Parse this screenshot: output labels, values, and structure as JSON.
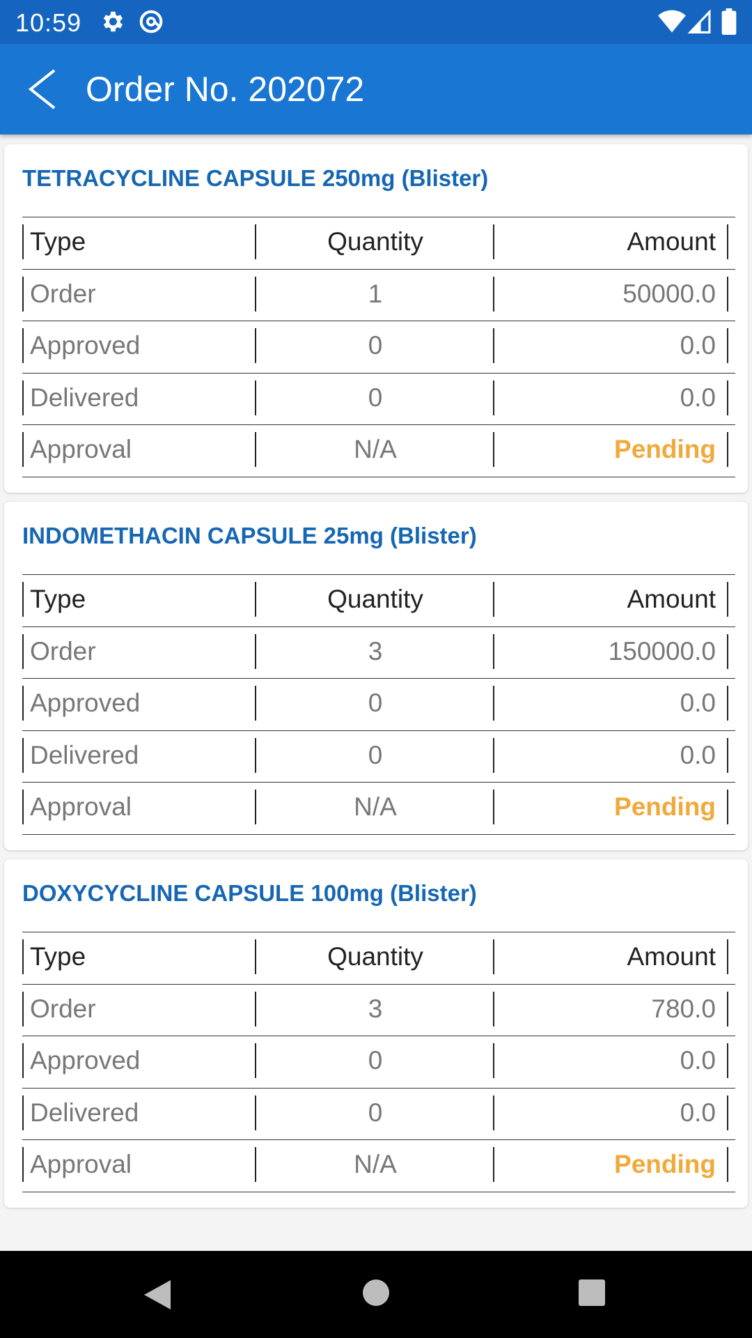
{
  "status_bar": {
    "time": "10:59",
    "icons": [
      "gear-icon",
      "at-sign-icon",
      "wifi-icon",
      "signal-icon",
      "battery-icon"
    ]
  },
  "app_bar": {
    "title": "Order No. 202072",
    "back_icon": "chevron-left-icon"
  },
  "table_headers": {
    "type": "Type",
    "quantity": "Quantity",
    "amount": "Amount"
  },
  "products": [
    {
      "name": "TETRACYCLINE CAPSULE 250mg (Blister)",
      "rows": [
        {
          "type": "Order",
          "quantity": "1",
          "amount": "50000.0"
        },
        {
          "type": "Approved",
          "quantity": "0",
          "amount": "0.0"
        },
        {
          "type": "Delivered",
          "quantity": "0",
          "amount": "0.0"
        },
        {
          "type": "Approval",
          "quantity": "N/A",
          "amount": "Pending"
        }
      ]
    },
    {
      "name": "INDOMETHACIN CAPSULE 25mg (Blister)",
      "rows": [
        {
          "type": "Order",
          "quantity": "3",
          "amount": "150000.0"
        },
        {
          "type": "Approved",
          "quantity": "0",
          "amount": "0.0"
        },
        {
          "type": "Delivered",
          "quantity": "0",
          "amount": "0.0"
        },
        {
          "type": "Approval",
          "quantity": "N/A",
          "amount": "Pending"
        }
      ]
    },
    {
      "name": "DOXYCYCLINE CAPSULE 100mg (Blister)",
      "rows": [
        {
          "type": "Order",
          "quantity": "3",
          "amount": "780.0"
        },
        {
          "type": "Approved",
          "quantity": "0",
          "amount": "0.0"
        },
        {
          "type": "Delivered",
          "quantity": "0",
          "amount": "0.0"
        },
        {
          "type": "Approval",
          "quantity": "N/A",
          "amount": "Pending"
        }
      ]
    }
  ],
  "colors": {
    "status_bar": "#1565c0",
    "app_bar": "#1976d2",
    "product_title": "#1667b3",
    "pending": "#f0a93a"
  },
  "nav_bar": {
    "buttons": [
      "back-triangle-icon",
      "home-circle-icon",
      "recents-square-icon"
    ]
  }
}
